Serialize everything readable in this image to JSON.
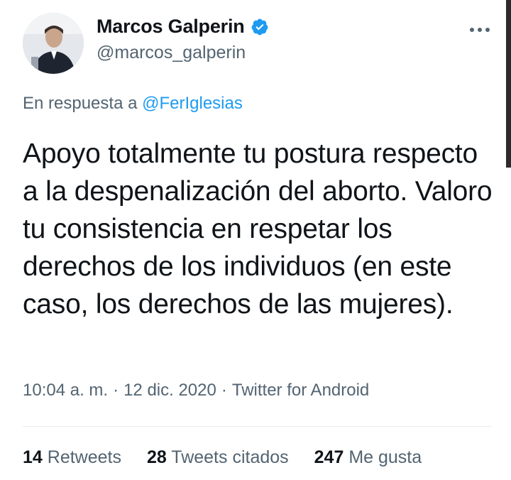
{
  "author": {
    "display_name": "Marcos Galperin",
    "handle": "@marcos_galperin",
    "verified": true
  },
  "menu": {
    "icon": "more-horizontal-icon"
  },
  "reply_to": {
    "prefix": "En respuesta a",
    "mention": "@FerIglesias"
  },
  "tweet_text": "Apoyo totalmente tu postura respecto a la despenalización del aborto. Valoro tu consistencia en respetar los derechos de los individuos (en este caso, los derechos de las mujeres).",
  "meta": {
    "time": "10:04 a. m.",
    "date": "12 dic. 2020",
    "source": "Twitter for Android",
    "separator": "·"
  },
  "stats": [
    {
      "count": "14",
      "label": "Retweets"
    },
    {
      "count": "28",
      "label": "Tweets citados"
    },
    {
      "count": "247",
      "label": "Me gusta"
    }
  ],
  "colors": {
    "link": "#1d9bf0",
    "secondary_text": "#536471",
    "primary_text": "#0f1419",
    "divider": "#e6ecf0"
  }
}
